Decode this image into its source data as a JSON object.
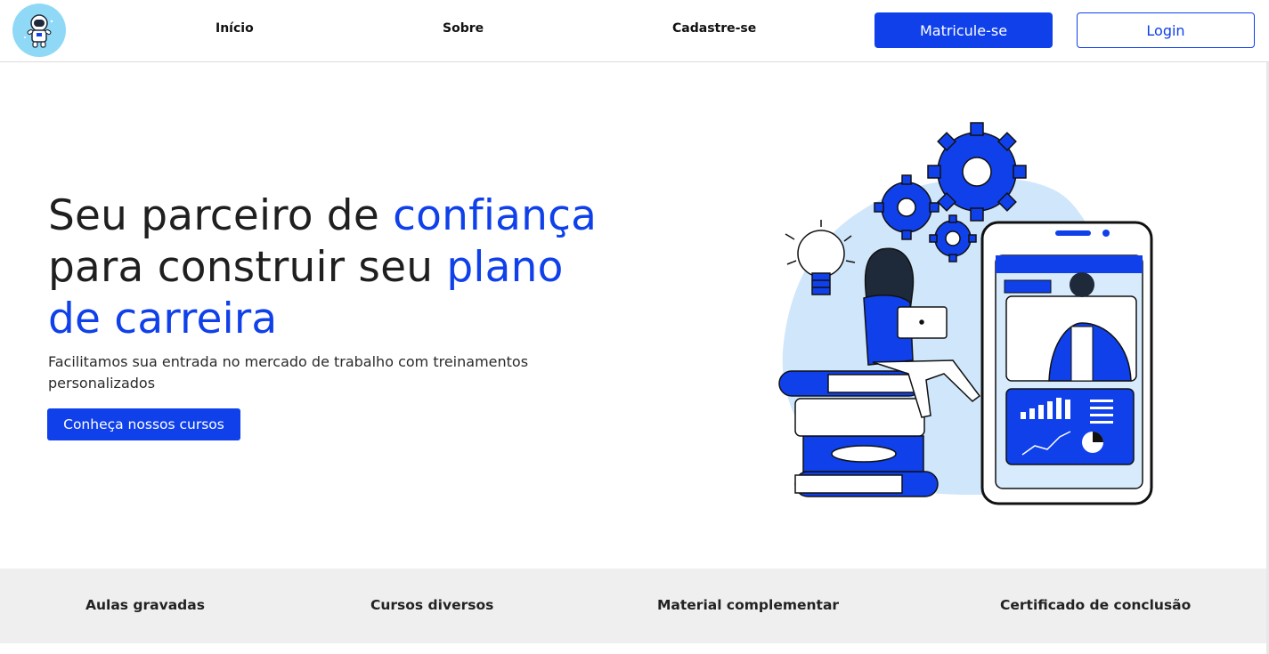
{
  "nav": {
    "links": [
      "Início",
      "Sobre",
      "Cadastre-se"
    ],
    "enroll_label": "Matricule-se",
    "login_label": "Login"
  },
  "hero": {
    "title_line1_plain": "Seu parceiro de ",
    "title_line1_accent": "confiança",
    "title_line2_plain": "para construir seu ",
    "title_line2_accent": "plano",
    "title_line3_accent": "de carreira",
    "subtitle": "Facilitamos sua entrada no mercado de trabalho com treinamentos personalizados",
    "cta_label": "Conheça nossos cursos"
  },
  "features": [
    "Aulas gravadas",
    "Cursos diversos",
    "Material complementar",
    "Certificado de conclusão"
  ],
  "colors": {
    "accent": "#0f40ea",
    "logo_bg": "#8fd9f7",
    "feature_bar": "#efefef",
    "illustration_blob": "#cfe6fb"
  },
  "icons": {
    "logo": "astronaut-icon"
  }
}
